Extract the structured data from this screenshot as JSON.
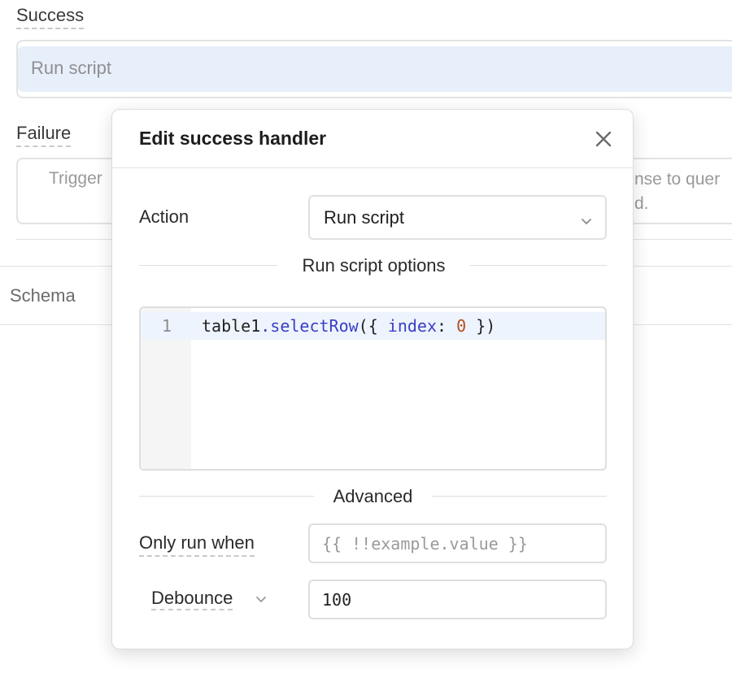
{
  "background": {
    "success_label": "Success",
    "success_value": "Run script",
    "failure_label": "Failure",
    "failure_text_left": "Trigger",
    "failure_text_right": "nse to quer\nd.",
    "schema_label": "Schema"
  },
  "modal": {
    "title": "Edit success handler",
    "action_label": "Action",
    "action_value": "Run script",
    "options_heading": "Run script options",
    "editor": {
      "line_number": "1",
      "code": {
        "obj": "table1",
        "dot": ".",
        "method": "selectRow",
        "open": "({ ",
        "prop": "index",
        "colon": ": ",
        "num": "0",
        "close": " })"
      }
    },
    "advanced_heading": "Advanced",
    "only_run_when_label": "Only run when",
    "only_run_when_placeholder": "{{ !!example.value }}",
    "debounce_label": "Debounce",
    "debounce_value": "100"
  },
  "icons": {
    "close": "close-icon",
    "select_chevron": "chevron-down-icon",
    "debounce_chevron": "chevron-down-icon"
  },
  "colors": {
    "selected_row_bg": "#e7effb",
    "active_line_bg": "#eef4fd",
    "code_method": "#3a3ec4",
    "code_number": "#b2501d"
  }
}
